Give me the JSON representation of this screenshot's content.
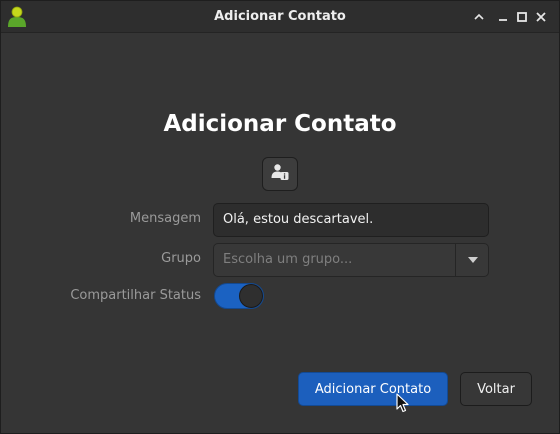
{
  "window": {
    "title": "Adicionar Contato",
    "icon": "contact-app-icon",
    "controls": [
      "chevron-up-icon",
      "minimize-icon",
      "maximize-icon",
      "close-icon"
    ]
  },
  "heading": "Adicionar Contato",
  "avatar_button": {
    "icon": "user-info-icon"
  },
  "form": {
    "message": {
      "label": "Mensagem",
      "value": "Olá, estou descartavel."
    },
    "group": {
      "label": "Grupo",
      "placeholder": "Escolha um grupo..."
    },
    "share_status": {
      "label": "Compartilhar Status",
      "enabled": true
    }
  },
  "buttons": {
    "primary_label": "Adicionar Contato",
    "secondary_label": "Voltar"
  },
  "colors": {
    "accent": "#1c5fbd",
    "background": "#353535",
    "titlebar": "#2e2e2e"
  }
}
